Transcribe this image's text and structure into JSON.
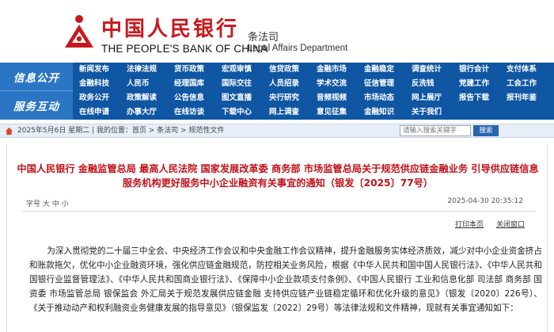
{
  "header": {
    "bank_name_cn": "中国人民银行",
    "bank_name_en": "THE PEOPLE'S BANK OF CHINA",
    "dept_cn": "条法司",
    "dept_en": "Legal Affairs Department",
    "brand_color": "#c8181e"
  },
  "nav": {
    "side_labels": [
      "信息公开",
      "服务互动"
    ],
    "rows": [
      [
        "新闻发布",
        "法律法规",
        "货币政策",
        "宏观审慎",
        "信贷政策",
        "金融市场",
        "金融稳定",
        "调查统计",
        "银行会计",
        "支付体系"
      ],
      [
        "金融科技",
        "人民币",
        "经理国库",
        "国际交往",
        "人员招录",
        "学术交流",
        "征信管理",
        "反洗钱",
        "党建工作",
        "工会工作"
      ],
      [
        "政务公开",
        "政策解读",
        "公告信息",
        "图文直播",
        "央行研究",
        "音频视频",
        "市场动态",
        "网上展厅",
        "报告下载",
        "报刊年鉴"
      ],
      [
        "在线申请",
        "办事大厅",
        "在线访谈",
        "下载中心",
        "网上调查",
        "意见征集",
        "金融知识",
        "关于我们",
        "",
        ""
      ]
    ],
    "bg_color": "#0f56a3"
  },
  "breadcrumb": {
    "text": "2025年5月6日 星期二 | 我的位置：首页 > 条法司 > 规范性文件",
    "search_placeholder": "请输入搜索关键字",
    "search_button": "搜索"
  },
  "article": {
    "title": "中国人民银行 金融监管总局 最高人民法院 国家发展改革委 商务部 市场监管总局关于规范供应链金融业务 引导供应链信息服务机构更好服务中小企业融资有关事宜的通知（银发〔2025〕77号）",
    "font_size_label": "字号 大 中 小",
    "date": "2025-04-30 20:35:12",
    "print_label": "打印本页",
    "close_label": "关闭窗口",
    "body": "为深入贯彻党的二十届三中全会、中央经济工作会议和中央金融工作会议精神，提升金融服务实体经济质效，减少对中小企业资金挤占和账款拖欠，优化中小企业融资环境，强化供应链金融规范，防控相关业务风险，根据《中华人民共和国中国人民银行法》、《中华人民共和国银行业监督管理法》、《中华人民共和国商业银行法》、《保障中小企业款项支付条例》、《中国人民银行 工业和信息化部 司法部 商务部 国资委 市场监管总局 银保监会 外汇局关于规范发展供应链金融 支持供应链产业链稳定循环和优化升级的意见》（银发〔2020〕226号）、《关于推动动产和权利融资业务健康发展的指导意见》（银保监发〔2022〕29号）等法律法规和文件精神，现就有关事宜通知如下：",
    "title_color": "#c1121a"
  }
}
